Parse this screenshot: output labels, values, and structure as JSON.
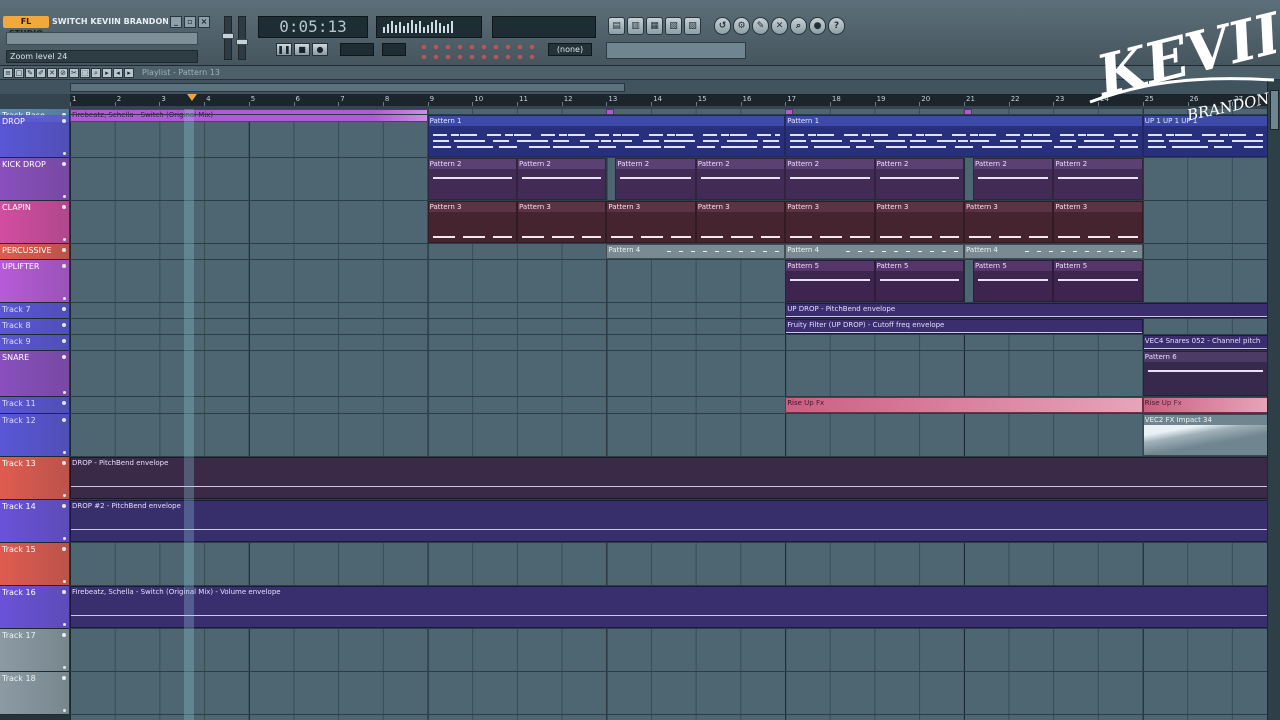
{
  "window": {
    "logo": "FL STUDIO",
    "project_title": "SWITCH KEVIIN BRANDON REM..."
  },
  "toolbar": {
    "zoom_hint": "Zoom level 24",
    "time": "0:05:13",
    "snap": "(none)"
  },
  "playlist": {
    "title": "Playlist - Pattern 13"
  },
  "ruler": [
    "1",
    "2",
    "3",
    "4",
    "5",
    "6",
    "7",
    "8",
    "9",
    "10",
    "11",
    "12",
    "13",
    "14",
    "15",
    "16",
    "17",
    "18",
    "19",
    "20",
    "21",
    "22",
    "23",
    "24",
    "25",
    "26",
    "27"
  ],
  "tracks": [
    {
      "label": "Track Base",
      "color": "#5f8db5",
      "text": "#ffffff"
    },
    {
      "label": "DROP",
      "color": "#5a56d6",
      "text": "#ffffff"
    },
    {
      "label": "KICK DROP",
      "color": "#8a4fbd",
      "text": "#ffffff"
    },
    {
      "label": "CLAPIN",
      "color": "#d24da0",
      "text": "#ffffff"
    },
    {
      "label": "PERCUSSIVE",
      "color": "#e05b4f",
      "text": "#ffffff"
    },
    {
      "label": "UPLIFTER",
      "color": "#b75bd8",
      "text": "#ffffff"
    },
    {
      "label": "Track 7",
      "color": "#5a56d6",
      "text": "#d9dcff"
    },
    {
      "label": "Track 8",
      "color": "#5a56d6",
      "text": "#d9dcff"
    },
    {
      "label": "Track 9",
      "color": "#5a56d6",
      "text": "#d9dcff"
    },
    {
      "label": "SNARE",
      "color": "#8a4fbd",
      "text": "#ffffff"
    },
    {
      "label": "Track 11",
      "color": "#5a56d6",
      "text": "#d9dcff"
    },
    {
      "label": "Track 12",
      "color": "#5a56d6",
      "text": "#d9dcff"
    },
    {
      "label": "Track 13",
      "color": "#e05b4f",
      "text": "#ffffff"
    },
    {
      "label": "Track 14",
      "color": "#6a52d8",
      "text": "#ffffff"
    },
    {
      "label": "Track 15",
      "color": "#e05b4f",
      "text": "#ffffff"
    },
    {
      "label": "Track 16",
      "color": "#6a52d8",
      "text": "#ffffff"
    },
    {
      "label": "Track 17",
      "color": "#8c9ba3",
      "text": "#eef3f5"
    },
    {
      "label": "Track 18",
      "color": "#8c9ba3",
      "text": "#eef3f5"
    }
  ],
  "clips": [
    {
      "track": 0,
      "start": 1,
      "end": 9,
      "name": "Firebeatz, Schella - Switch (Original Mix)",
      "color": "#b05bd6",
      "text": "#3a1250",
      "type": "audio"
    },
    {
      "track": 0,
      "start": 13,
      "end": 13.18,
      "name": "",
      "color": "#b05bd6",
      "text": "#3a1250",
      "type": "block"
    },
    {
      "track": 0,
      "start": 17,
      "end": 17.18,
      "name": "",
      "color": "#b05bd6",
      "text": "#3a1250",
      "type": "block"
    },
    {
      "track": 0,
      "start": 21,
      "end": 21.18,
      "name": "",
      "color": "#b05bd6",
      "text": "#3a1250",
      "type": "block"
    },
    {
      "track": 1,
      "start": 9,
      "end": 17,
      "name": "Pattern 1",
      "color": "#3e4aa8",
      "text": "#e5e8ff",
      "type": "notes"
    },
    {
      "track": 1,
      "start": 17,
      "end": 25,
      "name": "Pattern 1",
      "color": "#3e4aa8",
      "text": "#e5e8ff",
      "type": "notes"
    },
    {
      "track": 1,
      "start": 25,
      "end": 27.8,
      "name": "UP 1 UP 1 UP 1",
      "color": "#3e4aa8",
      "text": "#e5e8ff",
      "type": "notes"
    },
    {
      "track": 2,
      "start": 9,
      "end": 11,
      "name": "Pattern 2",
      "color": "#5b4073",
      "text": "#ecdcff",
      "type": "bar"
    },
    {
      "track": 2,
      "start": 11,
      "end": 13,
      "name": "Pattern 2",
      "color": "#5b4073",
      "text": "#ecdcff",
      "type": "bar"
    },
    {
      "track": 2,
      "start": 13.2,
      "end": 15,
      "name": "Pattern 2",
      "color": "#5b4073",
      "text": "#ecdcff",
      "type": "bar"
    },
    {
      "track": 2,
      "start": 15,
      "end": 17,
      "name": "Pattern 2",
      "color": "#5b4073",
      "text": "#ecdcff",
      "type": "bar"
    },
    {
      "track": 2,
      "start": 17,
      "end": 19,
      "name": "Pattern 2",
      "color": "#5b4073",
      "text": "#ecdcff",
      "type": "bar"
    },
    {
      "track": 2,
      "start": 19,
      "end": 21,
      "name": "Pattern 2",
      "color": "#5b4073",
      "text": "#ecdcff",
      "type": "bar"
    },
    {
      "track": 2,
      "start": 21.2,
      "end": 23,
      "name": "Pattern 2",
      "color": "#5b4073",
      "text": "#ecdcff",
      "type": "bar"
    },
    {
      "track": 2,
      "start": 23,
      "end": 25,
      "name": "Pattern 2",
      "color": "#5b4073",
      "text": "#ecdcff",
      "type": "bar"
    },
    {
      "track": 3,
      "start": 9,
      "end": 11,
      "name": "Pattern 3",
      "color": "#5b3343",
      "text": "#ffdce9",
      "type": "dash"
    },
    {
      "track": 3,
      "start": 11,
      "end": 13,
      "name": "Pattern 3",
      "color": "#5b3343",
      "text": "#ffdce9",
      "type": "dash"
    },
    {
      "track": 3,
      "start": 13,
      "end": 15,
      "name": "Pattern 3",
      "color": "#5b3343",
      "text": "#ffdce9",
      "type": "dash"
    },
    {
      "track": 3,
      "start": 15,
      "end": 17,
      "name": "Pattern 3",
      "color": "#5b3343",
      "text": "#ffdce9",
      "type": "dash"
    },
    {
      "track": 3,
      "start": 17,
      "end": 19,
      "name": "Pattern 3",
      "color": "#5b3343",
      "text": "#ffdce9",
      "type": "dash"
    },
    {
      "track": 3,
      "start": 19,
      "end": 21,
      "name": "Pattern 3",
      "color": "#5b3343",
      "text": "#ffdce9",
      "type": "dash"
    },
    {
      "track": 3,
      "start": 21,
      "end": 23,
      "name": "Pattern 3",
      "color": "#5b3343",
      "text": "#ffdce9",
      "type": "dash"
    },
    {
      "track": 3,
      "start": 23,
      "end": 25,
      "name": "Pattern 3",
      "color": "#5b3343",
      "text": "#ffdce9",
      "type": "dash"
    },
    {
      "track": 4,
      "start": 13,
      "end": 17,
      "name": "Pattern 4",
      "color": "#7a8a93",
      "text": "#eef3f5",
      "type": "thin"
    },
    {
      "track": 4,
      "start": 17,
      "end": 21,
      "name": "Pattern 4",
      "color": "#7a8a93",
      "text": "#eef3f5",
      "type": "thin"
    },
    {
      "track": 4,
      "start": 21,
      "end": 25,
      "name": "Pattern 4",
      "color": "#7a8a93",
      "text": "#eef3f5",
      "type": "thin"
    },
    {
      "track": 5,
      "start": 17,
      "end": 19,
      "name": "Pattern 5",
      "color": "#55356a",
      "text": "#f1dcff",
      "type": "bar"
    },
    {
      "track": 5,
      "start": 19,
      "end": 21,
      "name": "Pattern 5",
      "color": "#55356a",
      "text": "#f1dcff",
      "type": "bar"
    },
    {
      "track": 5,
      "start": 21.2,
      "end": 23,
      "name": "Pattern 5",
      "color": "#55356a",
      "text": "#f1dcff",
      "type": "bar"
    },
    {
      "track": 5,
      "start": 23,
      "end": 25,
      "name": "Pattern 5",
      "color": "#55356a",
      "text": "#f1dcff",
      "type": "bar"
    },
    {
      "track": 6,
      "start": 17,
      "end": 27.8,
      "name": "UP DROP - PitchBend envelope",
      "color": "#3b2e6e",
      "text": "#e4dcff",
      "type": "env"
    },
    {
      "track": 7,
      "start": 17,
      "end": 25,
      "name": "Fruity Filter (UP DROP) - Cutoff freq envelope",
      "color": "#3b2e6e",
      "text": "#e4dcff",
      "type": "env"
    },
    {
      "track": 8,
      "start": 25,
      "end": 27.8,
      "name": "VEC4 Snares 052 - Channel pitch",
      "color": "#3b2e6e",
      "text": "#e4dcff",
      "type": "env"
    },
    {
      "track": 9,
      "start": 25,
      "end": 27.8,
      "name": "Pattern 6",
      "color": "#4b3b66",
      "text": "#ecdcff",
      "type": "bar"
    },
    {
      "track": 10,
      "start": 17,
      "end": 25,
      "name": "Rise Up Fx",
      "color": "#c95a7d",
      "text": "#2a0b16",
      "type": "rise"
    },
    {
      "track": 10,
      "start": 25,
      "end": 27.8,
      "name": "Rise Up Fx",
      "color": "#c95a7d",
      "text": "#2a0b16",
      "type": "rise"
    },
    {
      "track": 11,
      "start": 25,
      "end": 27.8,
      "name": "VEC2 FX Impact 34",
      "color": "#6f8590",
      "text": "#eef3f5",
      "type": "impact"
    },
    {
      "track": 12,
      "start": 1,
      "end": 27.8,
      "name": "DROP - PitchBend envelope",
      "color": "#3a2a48",
      "text": "#e9dcff",
      "type": "env"
    },
    {
      "track": 13,
      "start": 1,
      "end": 27.8,
      "name": "DROP #2 - PitchBend envelope",
      "color": "#372f6c",
      "text": "#e4dcff",
      "type": "env"
    },
    {
      "track": 15,
      "start": 1,
      "end": 27.8,
      "name": "Firebeatz, Schella - Switch (Original Mix) - Volume envelope",
      "color": "#3a2f6e",
      "text": "#e4dcff",
      "type": "env"
    }
  ],
  "watermark": {
    "text_main": "KEVIIN",
    "text_sub": "BRANDON"
  },
  "icons": {
    "toolbar": [
      "playlist-icon",
      "piano-roll-icon",
      "channel-rack-icon",
      "mixer-icon",
      "browser-icon",
      "plugin-icon"
    ],
    "tools": [
      "undo-icon",
      "settings-icon",
      "draw-icon",
      "delete-icon",
      "zoom-icon",
      "help-icon"
    ]
  }
}
